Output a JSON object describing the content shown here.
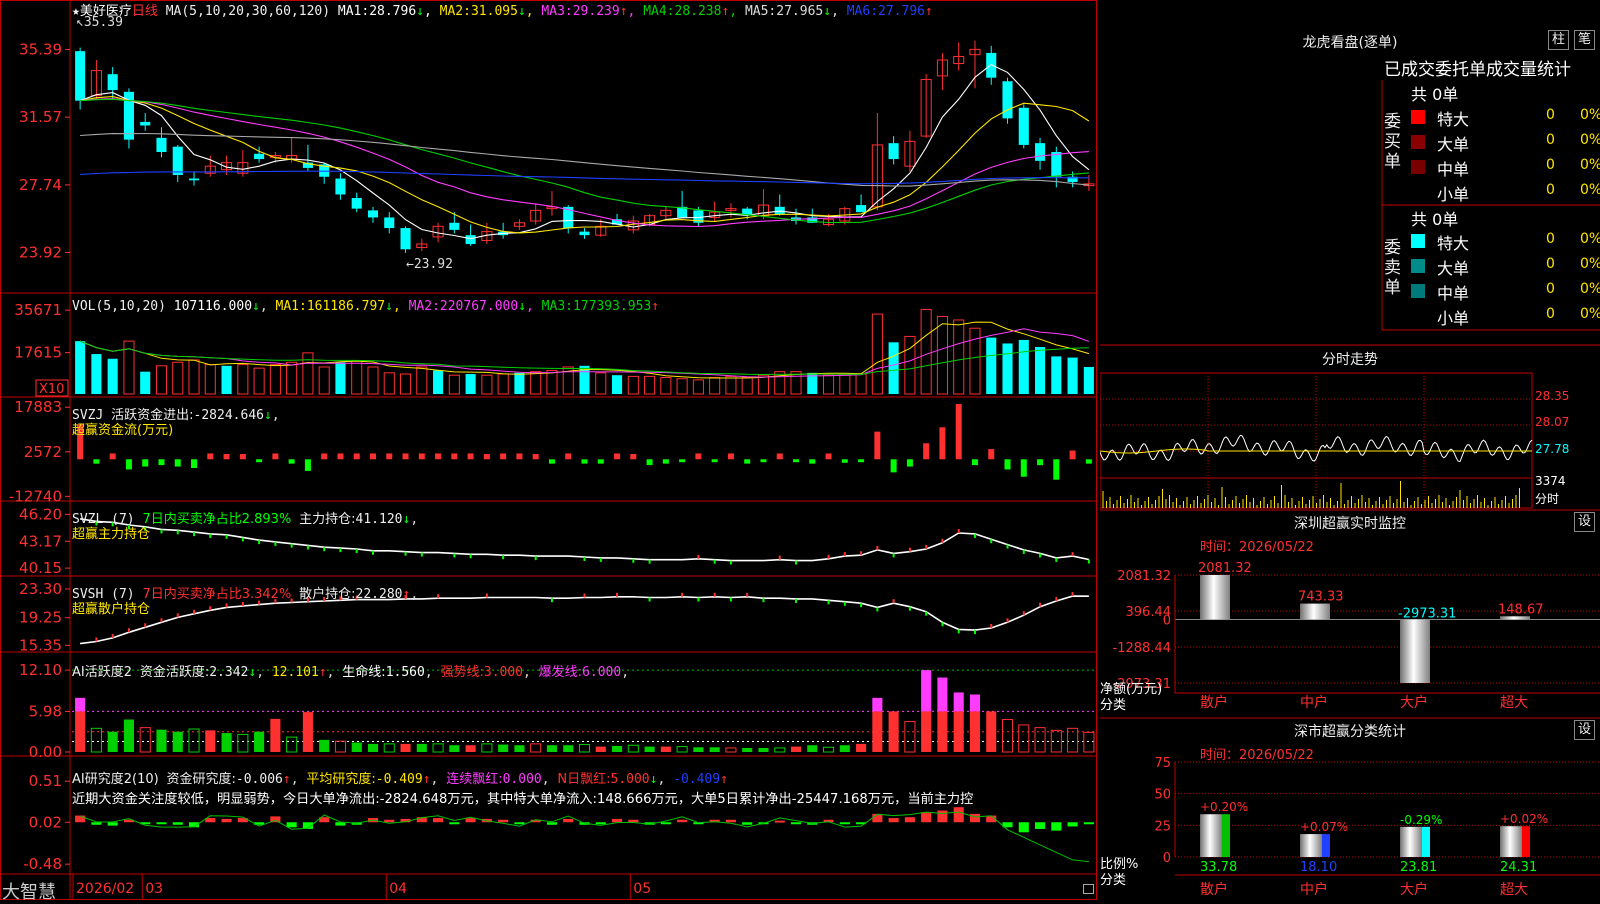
{
  "chart_data": [
    {
      "type": "candlestick",
      "name": "美好医疗",
      "period": "日线",
      "y_ticks": [
        "35.39",
        "31.57",
        "27.74",
        "23.92"
      ],
      "y_tick_values": [
        35.39,
        31.57,
        27.74,
        23.92
      ],
      "ylim": [
        21.8,
        37.4
      ],
      "x_labels": [
        "2026/02",
        "03",
        "04",
        "05"
      ],
      "x_label_index": [
        0,
        4,
        19,
        34
      ],
      "annotations": {
        "high": "35.39",
        "low": "23.92"
      },
      "ohlc": [
        [
          35.3,
          35.5,
          32.0,
          32.5
        ],
        [
          32.8,
          34.8,
          32.6,
          34.2
        ],
        [
          34.0,
          34.4,
          32.6,
          33.1
        ],
        [
          33.0,
          33.2,
          29.8,
          30.3
        ],
        [
          31.3,
          31.8,
          30.8,
          31.1
        ],
        [
          30.4,
          31.0,
          29.3,
          29.6
        ],
        [
          29.9,
          30.0,
          27.9,
          28.3
        ],
        [
          28.1,
          28.5,
          27.7,
          28.0
        ],
        [
          28.4,
          29.4,
          28.2,
          28.8
        ],
        [
          28.6,
          29.4,
          28.3,
          29.0
        ],
        [
          28.4,
          29.7,
          28.2,
          29.0
        ],
        [
          29.5,
          29.9,
          29.0,
          29.2
        ],
        [
          29.3,
          29.6,
          29.0,
          29.4
        ],
        [
          29.2,
          30.4,
          29.0,
          29.4
        ],
        [
          29.0,
          30.0,
          28.5,
          28.7
        ],
        [
          28.9,
          29.0,
          27.8,
          28.2
        ],
        [
          28.1,
          28.4,
          26.9,
          27.2
        ],
        [
          27.0,
          27.3,
          26.2,
          26.4
        ],
        [
          26.3,
          26.5,
          25.6,
          25.9
        ],
        [
          25.9,
          26.2,
          25.0,
          25.3
        ],
        [
          25.3,
          25.4,
          23.9,
          24.1
        ],
        [
          24.2,
          24.7,
          24.0,
          24.4
        ],
        [
          24.8,
          25.6,
          24.5,
          25.4
        ],
        [
          25.6,
          26.2,
          25.0,
          25.2
        ],
        [
          24.9,
          25.5,
          24.3,
          24.4
        ],
        [
          24.6,
          25.6,
          24.4,
          25.1
        ],
        [
          25.1,
          25.6,
          24.7,
          24.9
        ],
        [
          25.4,
          25.8,
          25.2,
          25.6
        ],
        [
          25.7,
          26.7,
          25.5,
          26.3
        ],
        [
          26.4,
          27.4,
          26.0,
          26.5
        ],
        [
          26.5,
          26.6,
          25.0,
          25.3
        ],
        [
          25.1,
          25.3,
          24.7,
          24.9
        ],
        [
          24.9,
          25.8,
          24.8,
          25.4
        ],
        [
          25.8,
          26.1,
          25.5,
          25.5
        ],
        [
          25.2,
          26.0,
          25.0,
          25.7
        ],
        [
          25.5,
          26.1,
          25.4,
          26.0
        ],
        [
          26.0,
          26.5,
          25.8,
          26.3
        ],
        [
          26.5,
          27.4,
          26.1,
          25.9
        ],
        [
          26.3,
          26.5,
          25.4,
          25.6
        ],
        [
          25.9,
          26.8,
          25.7,
          26.2
        ],
        [
          26.3,
          26.7,
          25.9,
          26.4
        ],
        [
          26.4,
          26.5,
          25.8,
          26.0
        ],
        [
          26.0,
          27.5,
          25.8,
          26.6
        ],
        [
          26.5,
          27.2,
          26.0,
          26.1
        ],
        [
          25.9,
          26.4,
          25.5,
          25.7
        ],
        [
          25.9,
          26.4,
          25.6,
          25.6
        ],
        [
          25.5,
          26.1,
          25.4,
          25.8
        ],
        [
          25.7,
          26.5,
          25.5,
          26.4
        ],
        [
          26.6,
          27.2,
          26.3,
          26.2
        ],
        [
          26.5,
          31.8,
          26.3,
          30.0
        ],
        [
          30.1,
          30.5,
          28.9,
          29.2
        ],
        [
          28.8,
          30.8,
          28.5,
          30.2
        ],
        [
          30.5,
          34.0,
          30.4,
          33.7
        ],
        [
          33.9,
          35.2,
          33.1,
          34.8
        ],
        [
          34.6,
          35.8,
          34.2,
          35.0
        ],
        [
          35.1,
          35.9,
          33.2,
          35.4
        ],
        [
          35.2,
          35.6,
          33.4,
          33.8
        ],
        [
          33.6,
          33.8,
          31.2,
          31.5
        ],
        [
          32.1,
          32.3,
          29.8,
          30.0
        ],
        [
          30.1,
          30.4,
          28.6,
          29.1
        ],
        [
          29.6,
          29.9,
          27.6,
          28.2
        ],
        [
          28.2,
          28.5,
          27.6,
          27.9
        ],
        [
          27.7,
          28.3,
          27.4,
          27.8
        ]
      ],
      "ma_series": [
        {
          "name": "MA1",
          "label": "MA1:",
          "value": "28.796",
          "color": "#ffffff",
          "period": 5
        },
        {
          "name": "MA2",
          "label": "MA2:",
          "value": "31.095",
          "color": "#ffe600",
          "period": 10
        },
        {
          "name": "MA3",
          "label": "MA3:",
          "value": "29.239",
          "color": "#ff3cff",
          "period": 20
        },
        {
          "name": "MA4",
          "label": "MA4:",
          "value": "28.238",
          "color": "#00d000",
          "period": 30
        },
        {
          "name": "MA5",
          "label": "MA5:",
          "value": "27.965",
          "color": "#a8a8a8",
          "period": 60
        },
        {
          "name": "MA6",
          "label": "MA6:",
          "value": "27.796",
          "color": "#2040ff",
          "period": 120
        }
      ]
    },
    {
      "type": "bar",
      "name": "VOL",
      "y_ticks": [
        "35671",
        "17615"
      ],
      "y_tick_values": [
        35671,
        17615
      ],
      "unit": "X10",
      "ylim": [
        0,
        40000
      ],
      "values": [
        22500,
        17000,
        15000,
        22500,
        9500,
        12000,
        13500,
        14500,
        12500,
        12000,
        12500,
        11000,
        12500,
        13500,
        17500,
        11500,
        13500,
        14000,
        11500,
        9000,
        8500,
        11500,
        10000,
        8000,
        8500,
        8000,
        8500,
        9000,
        9500,
        10000,
        11500,
        12000,
        9000,
        8000,
        7500,
        7500,
        7000,
        6500,
        6000,
        7000,
        7500,
        7000,
        8000,
        9500,
        9500,
        9000,
        8000,
        8000,
        8500,
        34000,
        22000,
        24500,
        36000,
        33000,
        31500,
        28000,
        24000,
        21500,
        23000,
        20000,
        16000,
        15500,
        11500
      ],
      "up": [
        0,
        0,
        0,
        1,
        0,
        1,
        1,
        1,
        1,
        0,
        1,
        1,
        1,
        1,
        1,
        1,
        0,
        1,
        1,
        1,
        1,
        1,
        0,
        1,
        0,
        1,
        1,
        0,
        1,
        1,
        1,
        0,
        1,
        0,
        1,
        1,
        1,
        1,
        1,
        1,
        1,
        1,
        1,
        1,
        1,
        0,
        1,
        1,
        1,
        1,
        0,
        1,
        1,
        1,
        1,
        1,
        0,
        0,
        0,
        0,
        0,
        0,
        0
      ],
      "ma_series": [
        {
          "name": "MA1",
          "label": "MA1:",
          "value": "161186.797",
          "color": "#ffe600"
        },
        {
          "name": "MA2",
          "label": "MA2:",
          "value": "220767.000",
          "color": "#ff3cff"
        },
        {
          "name": "MA3",
          "label": "MA3:",
          "value": "177393.953",
          "color": "#00d000"
        }
      ]
    },
    {
      "type": "bar",
      "name": "SVZJ",
      "y_ticks": [
        "17883",
        "2572",
        "-12740"
      ],
      "y_tick_values": [
        17883,
        2572,
        -12740
      ],
      "ylim": [
        -14000,
        19000
      ],
      "values": [
        12000,
        -1500,
        2000,
        -3500,
        -2500,
        -2000,
        -2500,
        -3000,
        2000,
        1800,
        1800,
        -1000,
        2000,
        -1500,
        -4000,
        2000,
        2000,
        2000,
        2000,
        2000,
        2000,
        2000,
        2000,
        2000,
        2000,
        1800,
        2000,
        2000,
        1800,
        -1500,
        2000,
        -1500,
        -1500,
        2000,
        1800,
        -2000,
        -1500,
        -1000,
        2000,
        -1000,
        2000,
        -1500,
        -1000,
        2000,
        -1000,
        -1500,
        2000,
        -1200,
        -1000,
        9500,
        -4500,
        -2500,
        5500,
        11000,
        19000,
        -2000,
        3500,
        -3500,
        -6000,
        -2000,
        -7000,
        3000,
        -1500
      ],
      "label": "SVZJ",
      "line_label": "活跃资金进出:",
      "line_value": "-2824.646",
      "subtitle": "超赢资金流(万元)"
    },
    {
      "type": "line",
      "name": "SVZL",
      "y_ticks": [
        "46.20",
        "43.17",
        "40.15"
      ],
      "y_tick_values": [
        46.2,
        43.17,
        40.15
      ],
      "ylim": [
        39.6,
        46.8
      ],
      "values": [
        45.7,
        45.4,
        45.3,
        45.0,
        44.8,
        44.5,
        44.4,
        44.2,
        44.0,
        43.9,
        43.6,
        43.3,
        43.1,
        42.9,
        42.7,
        42.5,
        42.4,
        42.3,
        42.1,
        42.1,
        42.0,
        41.9,
        41.9,
        41.8,
        41.7,
        41.7,
        41.6,
        41.6,
        41.5,
        41.5,
        41.5,
        41.4,
        41.3,
        41.3,
        41.2,
        41.1,
        41.1,
        41.1,
        41.2,
        41.1,
        41.0,
        41.0,
        41.0,
        41.1,
        41.0,
        41.0,
        41.2,
        41.5,
        41.6,
        42.2,
        41.8,
        42.0,
        42.3,
        43.0,
        44.1,
        44.0,
        43.4,
        42.8,
        42.2,
        41.8,
        41.3,
        41.5,
        41.12
      ],
      "label": "SVZL",
      "period": "(7)",
      "ratio_text": "7日内买卖净占比2.893%",
      "line_label": "主力持仓:",
      "line_value": "41.120",
      "subtitle": "超赢主力持仓"
    },
    {
      "type": "line",
      "name": "SVSH",
      "y_ticks": [
        "23.30",
        "19.25",
        "15.35"
      ],
      "y_tick_values": [
        23.3,
        19.25,
        15.35
      ],
      "ylim": [
        14.7,
        24.0
      ],
      "values": [
        15.6,
        15.9,
        16.4,
        17.2,
        17.9,
        18.6,
        19.3,
        19.8,
        20.3,
        20.7,
        20.9,
        21.1,
        21.3,
        21.4,
        21.5,
        21.6,
        21.7,
        21.8,
        21.8,
        21.8,
        21.9,
        21.9,
        22.0,
        22.0,
        22.0,
        22.1,
        22.1,
        22.1,
        22.1,
        22.0,
        22.0,
        22.1,
        22.1,
        22.2,
        22.2,
        22.1,
        22.1,
        22.2,
        22.1,
        22.2,
        22.1,
        22.2,
        22.0,
        22.0,
        21.9,
        21.9,
        21.7,
        21.5,
        21.3,
        20.7,
        21.3,
        20.8,
        20.1,
        18.6,
        17.6,
        17.5,
        17.8,
        18.6,
        19.6,
        20.8,
        21.6,
        22.3,
        22.28
      ],
      "label": "SVSH",
      "period": "(7)",
      "ratio_text": "7日内买卖净占比3.342%",
      "line_label": "散户持仓:",
      "line_value": "22.280",
      "subtitle": "超赢散户持仓"
    },
    {
      "type": "bar",
      "name": "AI活跃度2",
      "y_ticks": [
        "12.10",
        "5.98",
        "0.00"
      ],
      "y_tick_values": [
        12.1,
        5.98,
        0.0
      ],
      "ylim": [
        0,
        13.3
      ],
      "values": [
        8.0,
        3.5,
        3.0,
        4.8,
        3.6,
        3.3,
        3.0,
        3.4,
        3.2,
        2.8,
        2.6,
        3.0,
        4.9,
        2.2,
        5.9,
        1.8,
        1.6,
        1.4,
        1.2,
        1.2,
        1.2,
        1.2,
        1.2,
        1.0,
        1.0,
        1.2,
        1.1,
        1.0,
        1.2,
        1.0,
        1.0,
        1.1,
        0.8,
        0.9,
        1.0,
        0.8,
        0.8,
        0.8,
        0.7,
        0.7,
        0.6,
        0.6,
        0.6,
        0.6,
        0.8,
        1.0,
        0.7,
        1.0,
        1.2,
        8.0,
        6.0,
        4.5,
        12.1,
        11.0,
        8.8,
        8.5,
        6.0,
        4.8,
        4.0,
        3.6,
        3.2,
        3.5,
        2.9
      ],
      "label": "AI活跃度2",
      "line_label": "资金活跃度:",
      "line_value": "2.342",
      "value2": "12.101",
      "life_label": "生命线:",
      "life_value": "1.560",
      "strong_label": "强势线:",
      "strong_value": "3.000",
      "burst_label": "爆发线:",
      "burst_value": "6.000"
    },
    {
      "type": "bar",
      "name": "AI研究度2",
      "y_ticks": [
        "0.51",
        "0.02",
        "-0.48"
      ],
      "y_tick_values": [
        0.51,
        0.02,
        -0.48
      ],
      "ylim": [
        -0.55,
        0.62
      ],
      "values": [
        0.08,
        -0.03,
        -0.04,
        0.03,
        -0.02,
        -0.02,
        -0.03,
        -0.06,
        0.05,
        0.04,
        0.05,
        -0.03,
        0.07,
        -0.06,
        -0.08,
        0.06,
        -0.04,
        -0.03,
        0.05,
        0.03,
        0.04,
        0.06,
        0.05,
        -0.02,
        0.05,
        0.04,
        0.03,
        -0.02,
        0.03,
        -0.03,
        0.04,
        -0.03,
        -0.02,
        0.04,
        0.03,
        -0.03,
        -0.02,
        0.03,
        -0.02,
        0.03,
        0.03,
        -0.03,
        -0.02,
        0.02,
        -0.02,
        -0.03,
        0.03,
        -0.02,
        -0.02,
        0.1,
        0.05,
        0.06,
        0.12,
        0.14,
        0.18,
        0.1,
        0.08,
        -0.06,
        -0.12,
        -0.08,
        -0.1,
        -0.05,
        -0.02
      ],
      "label": "AI研究度2(10)",
      "line_label": "资金研究度:",
      "line_value": "-0.006",
      "avg_label": "平均研究度:",
      "avg_value": "-0.409",
      "lb_label": "连续飘红:",
      "lb_value": "0.000",
      "nd_label": "N日飘红:",
      "nd_value": "5.000",
      "last_value": "-0.409",
      "comment": "近期大资金关注度较低，明显弱势，今日大单净流出:-2824.648万元，其中特大单净流入:148.666万元，大单5日累计净出-25447.168万元，当前主力控"
    }
  ],
  "right_panel": {
    "dragon_title": "龙虎看盘(逐单)",
    "btn_zhu": "柱",
    "btn_bi": "笔",
    "stat_title": "已成交委托单成交量统计",
    "buy_label": "委买单",
    "sell_label": "委卖单",
    "buy_total": "共 0单",
    "sell_total": "共 0单",
    "buy_rows": [
      {
        "name": "特大",
        "count": "0",
        "pct": "0%",
        "color": "#ff0000"
      },
      {
        "name": "大单",
        "count": "0",
        "pct": "0%",
        "color": "#8b0000"
      },
      {
        "name": "中单",
        "count": "0",
        "pct": "0%",
        "color": "#7a0000"
      },
      {
        "name": "小单",
        "count": "0",
        "pct": "0%",
        "color": ""
      }
    ],
    "sell_rows": [
      {
        "name": "特大",
        "count": "0",
        "pct": "0%",
        "color": "#00ffff"
      },
      {
        "name": "大单",
        "count": "0",
        "pct": "0%",
        "color": "#008b8b"
      },
      {
        "name": "中单",
        "count": "0",
        "pct": "0%",
        "color": "#007a7a"
      },
      {
        "name": "小单",
        "count": "0",
        "pct": "0%",
        "color": ""
      }
    ],
    "intraday_title": "分时走势",
    "intraday_ticks": [
      "28.35",
      "28.07",
      "27.78"
    ],
    "intraday_vol": "3374",
    "intraday_vol_label": "分时",
    "sz_monitor_title": "深圳超赢实时监控",
    "btn_set": "设",
    "time_label": "时间：2026/05/22",
    "monitor_y_ticks": [
      "2081.32",
      "396.44",
      "0",
      "-1288.44",
      "-2973.31"
    ],
    "monitor_unit": "净额(万元)",
    "monitor_cat_label": "分类",
    "monitor_categories": [
      "散户",
      "中户",
      "大户",
      "超大"
    ],
    "monitor_values": [
      2081.32,
      743.33,
      -2973.31,
      148.67
    ],
    "monitor_value_labels": [
      "2081.32",
      "743.33",
      "-2973.31",
      "148.67"
    ],
    "sz_class_title": "深市超赢分类统计",
    "class_y_ticks": [
      "75",
      "50",
      "25",
      "0"
    ],
    "class_unit": "比例%",
    "class_values": [
      33.78,
      18.1,
      23.81,
      24.31
    ],
    "class_value_labels": [
      "33.78",
      "18.10",
      "23.81",
      "24.31"
    ],
    "class_change_labels": [
      "+0.20%",
      "+0.07%",
      "-0.29%",
      "+0.02%"
    ],
    "class_colors": [
      "#00c000",
      "#2040ff",
      "#00ffff",
      "#ff0000"
    ]
  },
  "app": {
    "logo": "大智慧",
    "star": "★",
    "stock_name": "美好医疗",
    "period": "日线",
    "ma_header": "MA(5,10,20,30,60,120)",
    "vol_header": "VOL(5,10,20)",
    "vol_value": "107116.000"
  }
}
